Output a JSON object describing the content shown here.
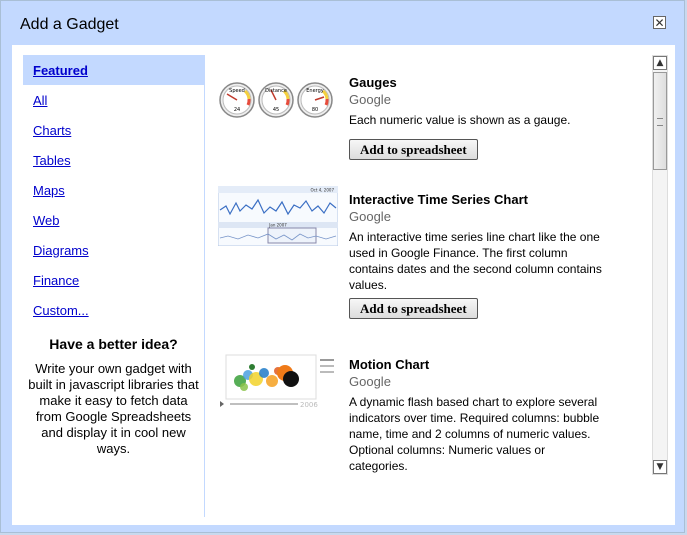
{
  "dialog": {
    "title": "Add a Gadget",
    "close_glyph": "✕"
  },
  "sidebar": {
    "items": [
      {
        "label": "Featured"
      },
      {
        "label": "All"
      },
      {
        "label": "Charts"
      },
      {
        "label": "Tables"
      },
      {
        "label": "Maps"
      },
      {
        "label": "Web"
      },
      {
        "label": "Diagrams"
      },
      {
        "label": "Finance"
      },
      {
        "label": "Custom..."
      }
    ],
    "selected": "Featured",
    "idea_title": "Have a better idea?",
    "idea_text": "Write your own gadget with built in javascript libraries that make it easy to fetch data from Google Spreadsheets and display it in cool new ways."
  },
  "gadgets": [
    {
      "name": "Gauges",
      "author": "Google",
      "description": "Each numeric value is shown as a gauge.",
      "button": "Add to spreadsheet",
      "thumb": {
        "labels": [
          "Speed",
          "Distance",
          "Energy"
        ],
        "values": [
          "24",
          "45",
          "80"
        ]
      }
    },
    {
      "name": "Interactive Time Series Chart",
      "author": "Google",
      "description": "An interactive time series line chart like the one used in Google Finance. The first column contains dates and the second column contains values.",
      "button": "Add to spreadsheet",
      "thumb": {
        "year_label": "Jan 2007",
        "date_range": "Oct 4, 2007"
      }
    },
    {
      "name": "Motion Chart",
      "author": "Google",
      "description": "A dynamic flash based chart to explore several indicators over time. Required columns: bubble name, time and 2 columns of numeric values. Optional columns: Numeric values or categories.",
      "thumb": {
        "year_label": "2006"
      }
    }
  ],
  "scrollbar": {
    "up_glyph": "▲",
    "down_glyph": "▼"
  }
}
